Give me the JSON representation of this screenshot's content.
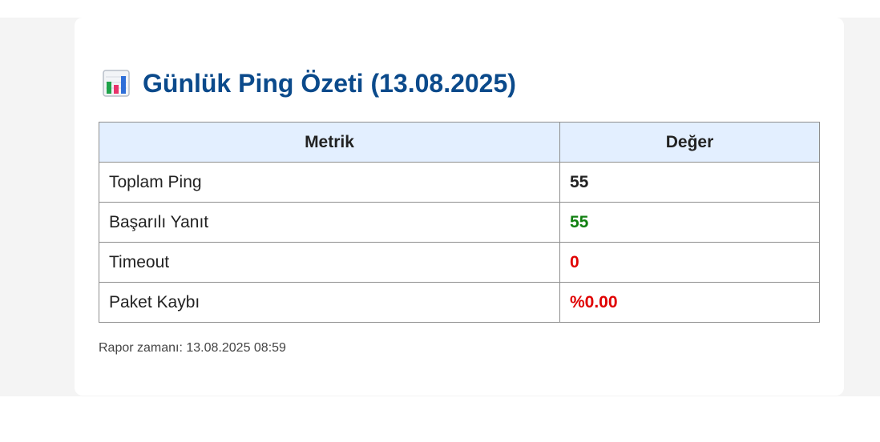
{
  "report": {
    "title": "Günlük Ping Özeti (13.08.2025)",
    "title_icon": "bar-chart-icon",
    "colors": {
      "title": "#0b4a8b",
      "header_bg": "#e3efff",
      "success": "#118011",
      "danger": "#e00000",
      "neutral": "#222222"
    },
    "table": {
      "headers": {
        "metric": "Metrik",
        "value": "Değer"
      },
      "rows": [
        {
          "metric": "Toplam Ping",
          "value": "55",
          "status": "neutral"
        },
        {
          "metric": "Başarılı Yanıt",
          "value": "55",
          "status": "success"
        },
        {
          "metric": "Timeout",
          "value": "0",
          "status": "danger"
        },
        {
          "metric": "Paket Kaybı",
          "value": "%0.00",
          "status": "danger"
        }
      ]
    },
    "footer": "Rapor zamanı: 13.08.2025 08:59"
  }
}
